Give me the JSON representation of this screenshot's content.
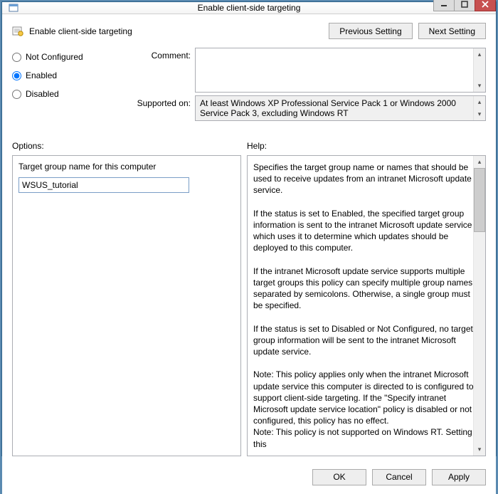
{
  "window": {
    "title": "Enable client-side targeting"
  },
  "header": {
    "title": "Enable client-side targeting",
    "prev_label": "Previous Setting",
    "next_label": "Next Setting"
  },
  "radios": {
    "not_configured": "Not Configured",
    "enabled": "Enabled",
    "disabled": "Disabled",
    "selected": "enabled"
  },
  "labels": {
    "comment": "Comment:",
    "supported_on": "Supported on:",
    "options": "Options:",
    "help": "Help:"
  },
  "comment": {
    "value": ""
  },
  "supported": {
    "text": "At least Windows XP Professional Service Pack 1 or Windows 2000 Service Pack 3, excluding Windows RT"
  },
  "options": {
    "target_label": "Target group name for this computer",
    "target_value": "WSUS_tutorial"
  },
  "help": {
    "text": "Specifies the target group name or names that should be used to receive updates from an intranet Microsoft update service.\n\nIf the status is set to Enabled, the specified target group information is sent to the intranet Microsoft update service which uses it to determine which updates should be deployed to this computer.\n\nIf the intranet Microsoft update service supports multiple target groups this policy can specify multiple group names separated by semicolons. Otherwise, a single group must be specified.\n\nIf the status is set to Disabled or Not Configured, no target group information will be sent to the intranet Microsoft update service.\n\nNote: This policy applies only when the intranet Microsoft update service this computer is directed to is configured to support client-side targeting. If the \"Specify intranet Microsoft update service location\" policy is disabled or not configured, this policy has no effect.\nNote: This policy is not supported on Windows RT. Setting this"
  },
  "footer": {
    "ok": "OK",
    "cancel": "Cancel",
    "apply": "Apply"
  }
}
